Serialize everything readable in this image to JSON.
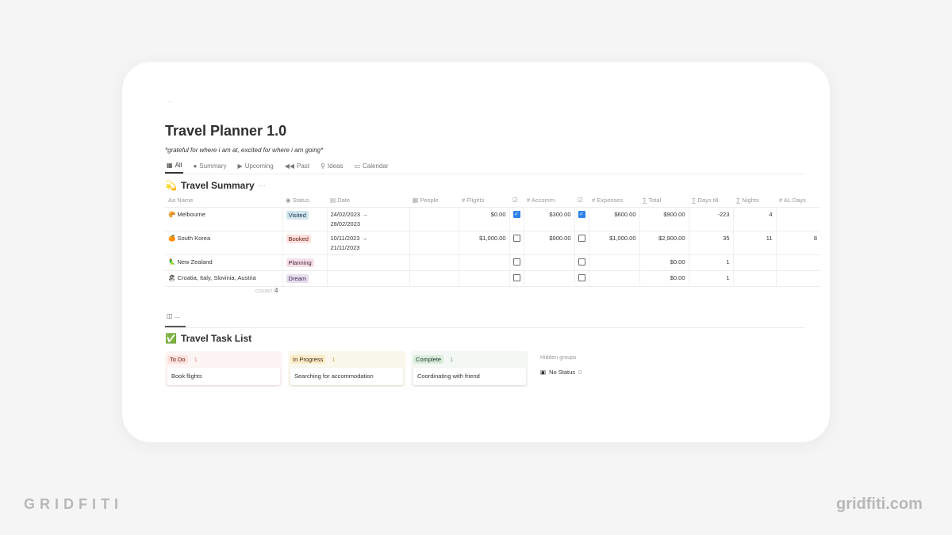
{
  "page": {
    "breadcrumb": "· · ·",
    "title": "Travel Planner 1.0",
    "subtitle": "*grateful for where i am at, excited for where i am going*"
  },
  "tabs": [
    {
      "icon": "table-icon",
      "glyph": "▦",
      "label": "All",
      "active": true
    },
    {
      "icon": "pie-icon",
      "glyph": "●",
      "label": "Summary"
    },
    {
      "icon": "play-icon",
      "glyph": "▶",
      "label": "Upcoming"
    },
    {
      "icon": "rewind-icon",
      "glyph": "◀◀",
      "label": "Past"
    },
    {
      "icon": "pin-icon",
      "glyph": "⚲",
      "label": "Ideas"
    },
    {
      "icon": "calendar-icon",
      "glyph": "▭",
      "label": "Calendar"
    }
  ],
  "summary": {
    "icon": "💫",
    "title": "Travel Summary",
    "more": "···",
    "columns": [
      {
        "icon": "Aa",
        "label": "Name"
      },
      {
        "icon": "◉",
        "label": "Status"
      },
      {
        "icon": "▤",
        "label": "Date"
      },
      {
        "icon": "▦",
        "label": "People"
      },
      {
        "icon": "#",
        "label": "Flights"
      },
      {
        "icon": "☑",
        "label": ""
      },
      {
        "icon": "#",
        "label": "Accomm."
      },
      {
        "icon": "☑",
        "label": ""
      },
      {
        "icon": "#",
        "label": "Expenses"
      },
      {
        "icon": "∑",
        "label": "Total"
      },
      {
        "icon": "∑",
        "label": "Days till"
      },
      {
        "icon": "∑",
        "label": "Nights"
      },
      {
        "icon": "#",
        "label": "AL Days"
      }
    ],
    "rows": [
      {
        "emoji": "🥐",
        "name": "Melbourne",
        "status": "Visited",
        "status_bg": "#d3e5ef",
        "status_fg": "#183347",
        "date1": "24/02/2023 →",
        "date2": "28/02/2023",
        "people": "",
        "flights": "$0.00",
        "flights_paid": true,
        "accomm": "$300.00",
        "accomm_paid": true,
        "expenses": "$600.00",
        "total": "$900.00",
        "days_till": "-223",
        "nights": "4",
        "al_days": ""
      },
      {
        "emoji": "🍊",
        "name": "South Korea",
        "status": "Booked",
        "status_bg": "#ffe2dd",
        "status_fg": "#5d1715",
        "date1": "10/11/2023 →",
        "date2": "21/11/2023",
        "people": "",
        "flights": "$1,000.00",
        "flights_paid": false,
        "accomm": "$900.00",
        "accomm_paid": false,
        "expenses": "$1,000.00",
        "total": "$2,900.00",
        "days_till": "35",
        "nights": "11",
        "al_days": "8"
      },
      {
        "emoji": "🦜",
        "name": "New Zealand",
        "status": "Planning",
        "status_bg": "#f5e0e9",
        "status_fg": "#4c2337",
        "date1": "",
        "date2": "",
        "people": "",
        "flights": "",
        "flights_paid": false,
        "accomm": "",
        "accomm_paid": false,
        "expenses": "",
        "total": "$0.00",
        "days_till": "1",
        "nights": "",
        "al_days": ""
      },
      {
        "emoji": "🏖",
        "name": "Croatia, Italy, Slovinia, Austria",
        "status": "Dream",
        "status_bg": "#e8deee",
        "status_fg": "#412454",
        "date1": "",
        "date2": "",
        "people": "",
        "flights": "",
        "flights_paid": false,
        "accomm": "",
        "accomm_paid": false,
        "expenses": "",
        "total": "$0.00",
        "days_till": "1",
        "nights": "",
        "al_days": ""
      }
    ],
    "count_label": "COUNT",
    "count_value": "4"
  },
  "board_view": {
    "icon": "board-icon",
    "glyph": "◫",
    "label": "..."
  },
  "tasks": {
    "icon": "✅",
    "title": "Travel Task List",
    "columns": [
      {
        "label": "To Do",
        "count": "1",
        "bg": "#fdf5f3",
        "pill_bg": "#ffe2dd",
        "pill_fg": "#5d1715",
        "count_fg": "#e0908a",
        "card": "Book flights"
      },
      {
        "label": "In Progress",
        "count": "1",
        "bg": "#faf7ed",
        "pill_bg": "#fdecc8",
        "pill_fg": "#402c1b",
        "count_fg": "#d9a54a",
        "card": "Searching for accommodation"
      },
      {
        "label": "Complete",
        "count": "1",
        "bg": "#f4f8f5",
        "pill_bg": "#dbeddb",
        "pill_fg": "#1c3829",
        "count_fg": "#7fb08a",
        "card": "Coordinating with friend"
      }
    ],
    "hidden_groups_label": "Hidden groups",
    "no_status_label": "No Status",
    "no_status_count": "0"
  },
  "watermark": {
    "left": "GRIDFITI",
    "right": "gridfiti.com"
  }
}
